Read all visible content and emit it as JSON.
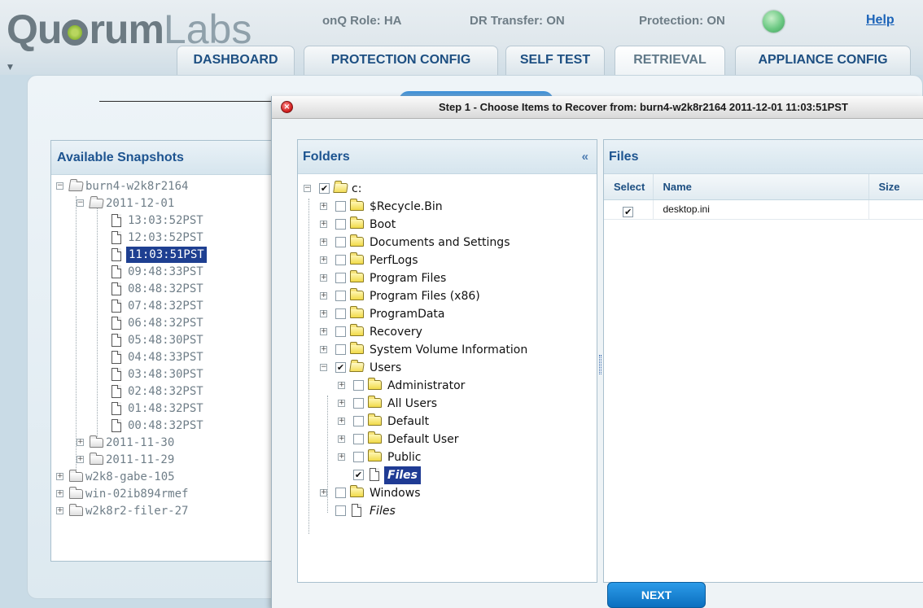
{
  "header": {
    "logo_bold_1": "Qu",
    "logo_bold_2": "rum",
    "logo_light": "Labs",
    "role": "onQ Role: HA",
    "dr_transfer": "DR Transfer: ON",
    "protection": "Protection: ON",
    "protection_led_color": "#6cc983",
    "help": "Help",
    "menu_toggle": "▼"
  },
  "tabs": [
    {
      "label": "DASHBOARD"
    },
    {
      "label": "PROTECTION CONFIG"
    },
    {
      "label": "SELF TEST"
    },
    {
      "label": "RETRIEVAL"
    },
    {
      "label": "APPLIANCE CONFIG"
    }
  ],
  "snapshots": {
    "title": "Available Snapshots",
    "server": "burn4-w2k8r2164",
    "date_open": "2011-12-01",
    "times": [
      "13:03:52PST",
      "12:03:52PST",
      "11:03:51PST",
      "09:48:33PST",
      "08:48:32PST",
      "07:48:32PST",
      "06:48:32PST",
      "05:48:30PST",
      "04:48:33PST",
      "03:48:30PST",
      "02:48:32PST",
      "01:48:32PST",
      "00:48:32PST"
    ],
    "dates_closed": [
      "2011-11-30",
      "2011-11-29"
    ],
    "other_servers": [
      "w2k8-gabe-105",
      "win-02ib894rmef",
      "w2k8r2-filer-27"
    ],
    "expand_minus": "−",
    "expand_plus": "+"
  },
  "dialog": {
    "close_glyph": "×",
    "title": "Step 1 - Choose Items to Recover from: burn4-w2k8r2164 2011-12-01 11:03:51PST",
    "next_label": "NEXT"
  },
  "folders": {
    "title": "Folders",
    "collapse_glyph": "«",
    "check": "✔",
    "root": "c:",
    "top_items": [
      "$Recycle.Bin",
      "Boot",
      "Documents and Settings",
      "PerfLogs",
      "Program Files",
      "Program Files (x86)",
      "ProgramData",
      "Recovery",
      "System Volume Information"
    ],
    "users": "Users",
    "user_items": [
      "Administrator",
      "All Users",
      "Default",
      "Default User",
      "Public"
    ],
    "users_files": "Files",
    "windows": "Windows",
    "root_files": "Files"
  },
  "files": {
    "title": "Files",
    "columns": [
      "Select",
      "Name",
      "Size"
    ],
    "rows": [
      {
        "checked": "✔",
        "name": "desktop.ini",
        "size": ""
      }
    ]
  }
}
